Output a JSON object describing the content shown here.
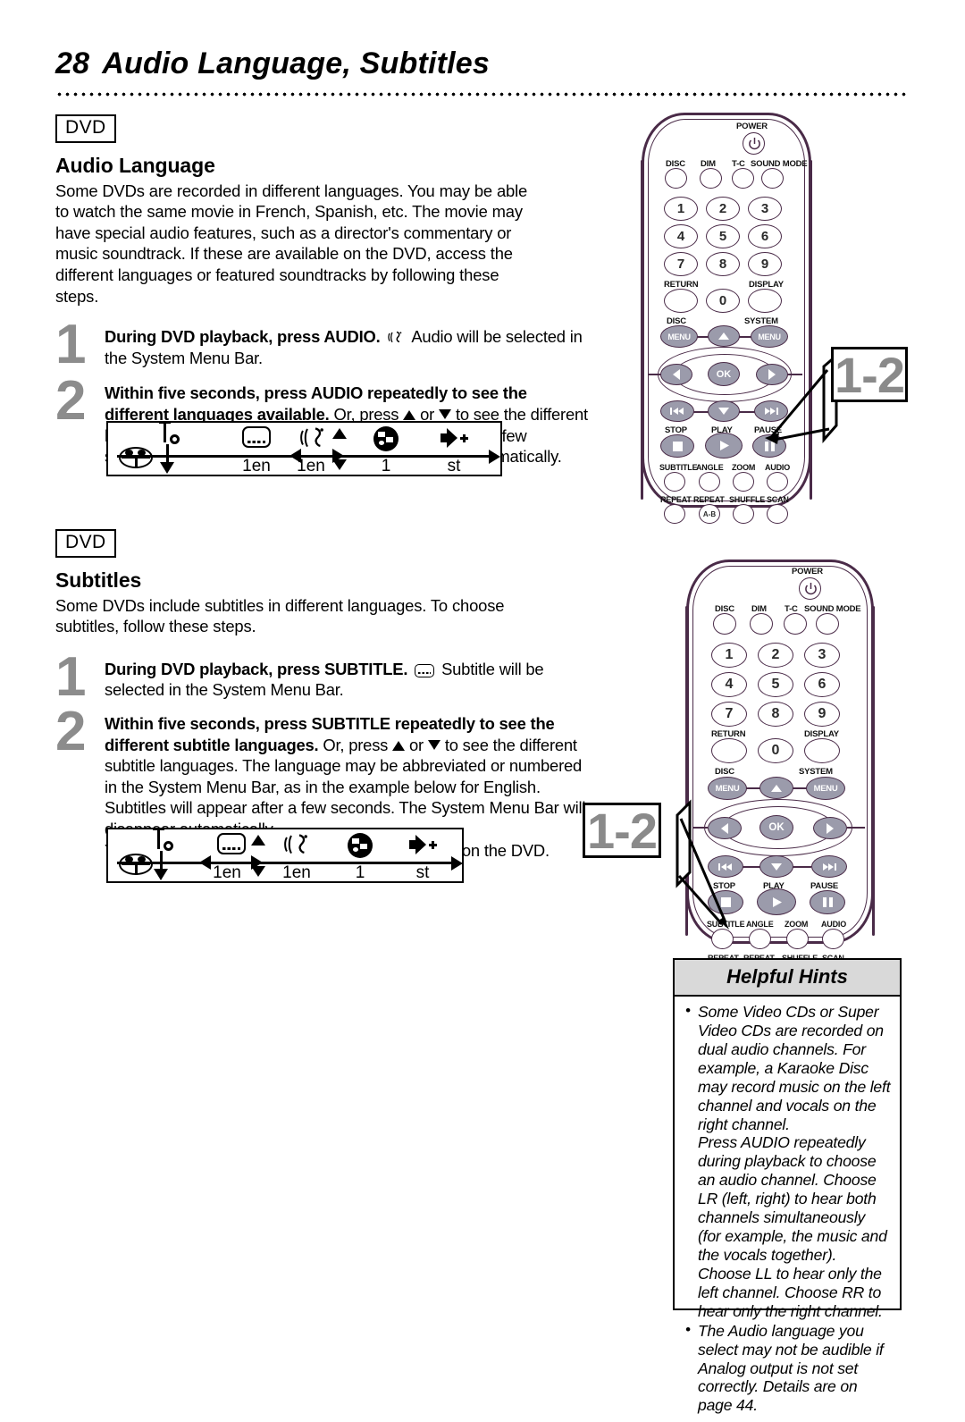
{
  "page": {
    "number": "28",
    "title": "Audio Language, Subtitles"
  },
  "badges": {
    "dvd": "DVD"
  },
  "sections": [
    {
      "heading": "Audio Language",
      "intro": "Some DVDs are recorded in different languages. You may be able to watch the same movie in French, Spanish, etc. The movie may have special audio features, such as a director's commentary or music soundtrack. If these are available on the DVD, access the different languages or featured soundtracks by following these steps.",
      "steps": [
        {
          "num": "1",
          "bold": "During DVD playback, press AUDIO.",
          "rest": "Audio will be selected in the System Menu Bar."
        },
        {
          "num": "2",
          "bold": "Within five seconds, press AUDIO repeatedly to see the different languages available.",
          "rest_a": "Or, press",
          "rest_b": "or",
          "rest_c": "to see the different languages. The language you select will be audible in a few seconds, and the System Menu Bar will disappear automatically."
        }
      ]
    },
    {
      "heading": "Subtitles",
      "intro": "Some DVDs include subtitles in different languages. To choose subtitles, follow these steps.",
      "steps": [
        {
          "num": "1",
          "bold": "During DVD playback, press SUBTITLE.",
          "rest": "Subtitle will be selected in the System Menu Bar."
        },
        {
          "num": "2",
          "bold": "Within five seconds, press SUBTITLE repeatedly to see the different subtitle languages.",
          "rest_a": "Or, press",
          "rest_b": "or",
          "rest_c": "to see the different subtitle languages. The language may be abbreviated or numbered in the System Menu Bar, as in the example below for English. Subtitles will appear after a few seconds. The System Menu Bar will disappear automatically.",
          "extra": "You can choose subtitles only if they are available on the DVD."
        }
      ]
    }
  ],
  "menu_bars": [
    {
      "id": "audio-menu-bar",
      "selected": "audio",
      "cells": [
        {
          "icon": "disc-icon",
          "label": ""
        },
        {
          "icon": "tools-icon",
          "label": ""
        },
        {
          "icon": "subtitle-icon",
          "label": "1en"
        },
        {
          "icon": "audio-icon",
          "label": "1en"
        },
        {
          "icon": "angle-icon",
          "label": "1"
        },
        {
          "icon": "sound-icon",
          "label": "st"
        }
      ]
    },
    {
      "id": "subtitle-menu-bar",
      "selected": "subtitle",
      "cells": [
        {
          "icon": "disc-icon",
          "label": ""
        },
        {
          "icon": "tools-icon",
          "label": ""
        },
        {
          "icon": "subtitle-icon",
          "label": "1en"
        },
        {
          "icon": "audio-icon",
          "label": "1en"
        },
        {
          "icon": "angle-icon",
          "label": "1"
        },
        {
          "icon": "sound-icon",
          "label": "st"
        }
      ]
    }
  ],
  "remote": {
    "power_label": "POWER",
    "top_row": [
      "DISC",
      "DIM",
      "T-C",
      "SOUND MODE"
    ],
    "keys": [
      "1",
      "2",
      "3",
      "4",
      "5",
      "6",
      "7",
      "8",
      "9",
      "0"
    ],
    "return_label": "RETURN",
    "display_label": "DISPLAY",
    "disc_menu_label": "DISC",
    "system_menu_label": "SYSTEM",
    "menu_btn_label": "MENU",
    "ok_label": "OK",
    "transport_labels": [
      "STOP",
      "PLAY",
      "PAUSE"
    ],
    "func_row": [
      "SUBTITLE",
      "ANGLE",
      "ZOOM",
      "AUDIO"
    ],
    "bottom_row": [
      "REPEAT",
      "REPEAT",
      "SHUFFLE",
      "SCAN"
    ],
    "ab_label": "A-B"
  },
  "callouts": [
    {
      "id": "callout-audio",
      "text": "1-2",
      "points_to": "AUDIO"
    },
    {
      "id": "callout-subtitle",
      "text": "1-2",
      "points_to": "SUBTITLE"
    }
  ],
  "helpful_hints": {
    "title": "Helpful Hints",
    "items": [
      {
        "text": "Some Video CDs or Super Video CDs are recorded on dual audio channels. For example, a Karaoke Disc may record music on the left channel and vocals on the right channel.",
        "continuation": "Press AUDIO repeatedly during playback to choose an audio channel. Choose LR (left, right) to hear both channels simultaneously (for example, the music and the vocals together). Choose LL to hear only the left channel. Choose RR to hear only the right channel."
      },
      {
        "text": "The Audio language you select may not be audible if Analog output is not set correctly. Details are on page 44."
      }
    ]
  },
  "colors": {
    "step_number": "#8c8c8c",
    "callout_text": "#8a8a8a",
    "remote_outline": "#4a2b48",
    "remote_gray_button": "#9b9bab",
    "hints_header_bg": "#d9d9d9"
  }
}
